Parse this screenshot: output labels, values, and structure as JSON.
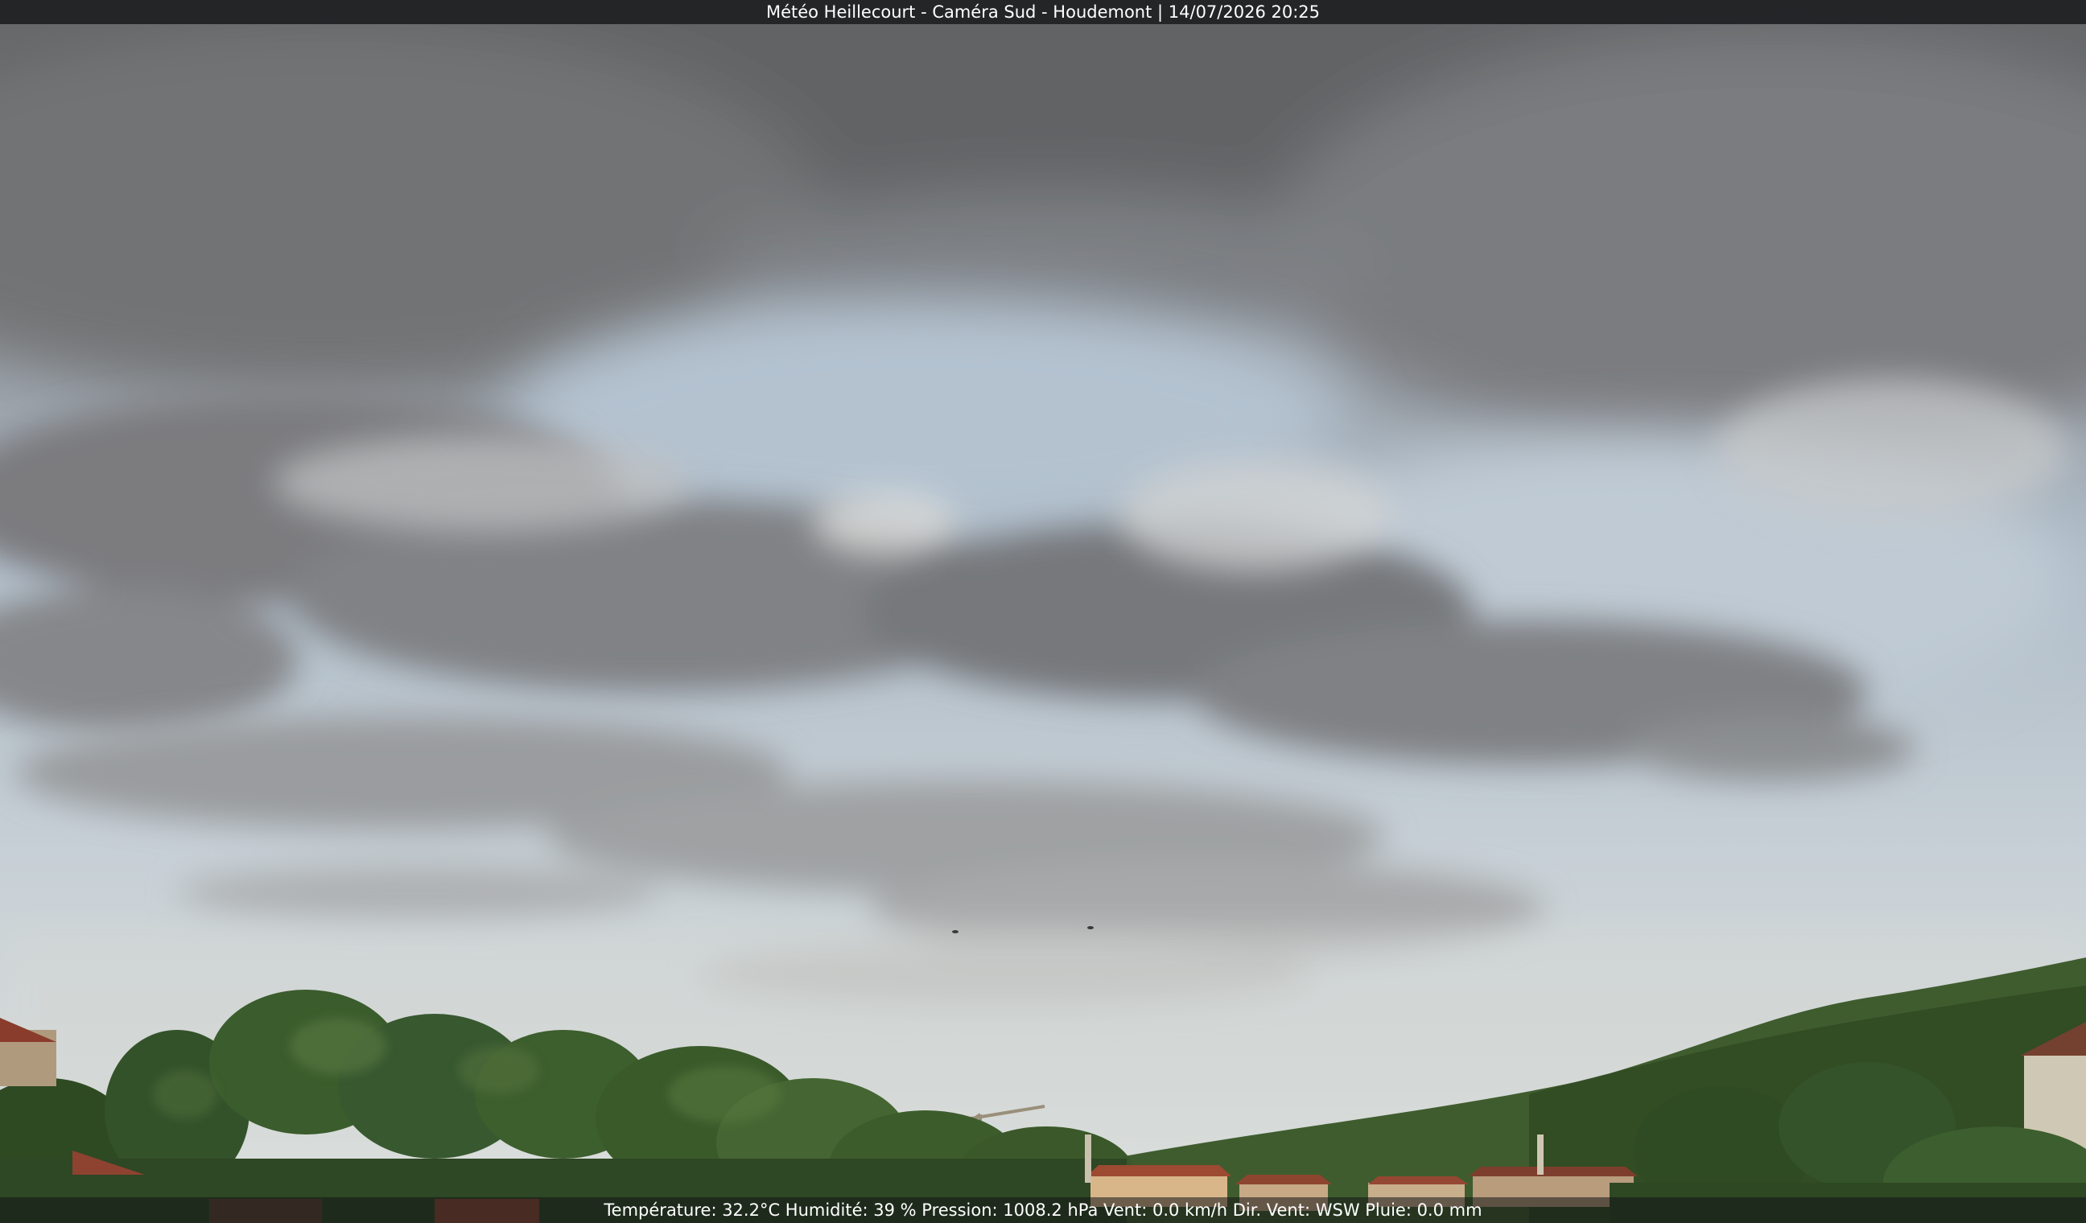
{
  "overlay": {
    "title": "Météo Heillecourt - Caméra Sud - Houdemont | 14/07/2026 20:25",
    "weather_line": "Température: 32.2°C  Humidité: 39 % Pression: 1008.2 hPa Vent: 0.0 km/h Dir. Vent: WSW Pluie: 0.0 mm"
  },
  "scene": {
    "subject": "webcam-sky-view",
    "colors": {
      "sky_top": "#6f7072",
      "sky_mid": "#b7c3cf",
      "sky_horizon": "#d9dcd8",
      "cloud_dark": "#5f6063",
      "cloud_light": "#c9ccce",
      "trees": "#3c5a2c",
      "trees_dark": "#22361a",
      "roofs": "#8a3e2c"
    }
  }
}
